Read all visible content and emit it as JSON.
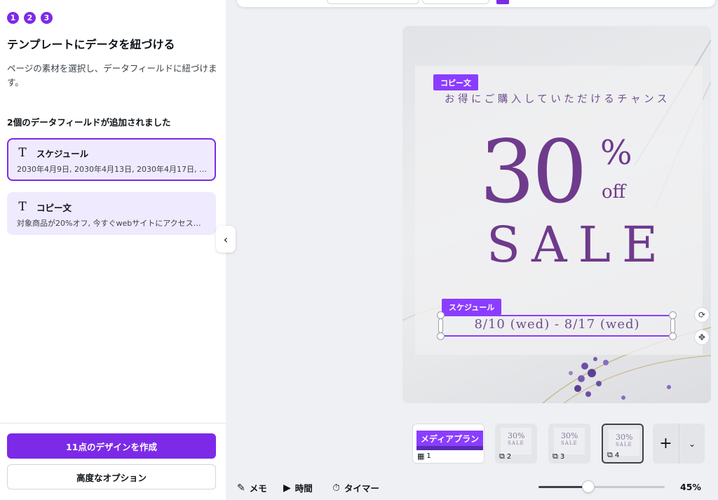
{
  "steps": [
    "1",
    "2",
    "3"
  ],
  "panel": {
    "title": "テンプレートにデータを紐づける",
    "description": "ページの素材を選択し、データフィールドに紐づけます。",
    "added_count": "2個のデータフィールドが追加されました",
    "fields": [
      {
        "icon": "text-icon",
        "name": "スケジュール",
        "value": "2030年4月9日, 2030年4月13日, 2030年4月17日, そ…"
      },
      {
        "icon": "text-icon",
        "name": "コピー文",
        "value": "対象商品が20%オフ, 今すぐwebサイトにアクセスし…"
      }
    ],
    "create_button": "11点のデザインを作成",
    "advanced_button": "高度なオプション"
  },
  "canvas": {
    "tag_copy": "コピー文",
    "headline": "お得にご購入していただけるチャンス",
    "big_number": "30",
    "percent": "%",
    "off": "off",
    "sale": "SALE",
    "tag_schedule": "スケジュール",
    "date_text": "8/10 (wed) - 8/17 (wed)"
  },
  "pages": {
    "items": [
      {
        "label": "1",
        "kind": "table",
        "banner": "メディアプラン"
      },
      {
        "label": "2",
        "kind": "design"
      },
      {
        "label": "3",
        "kind": "design"
      },
      {
        "label": "4",
        "kind": "design",
        "active": true
      }
    ],
    "thumb_30": "30%",
    "thumb_sale": "SALE"
  },
  "footer": {
    "notes": "メモ",
    "duration": "時間",
    "timer": "タイマー",
    "zoom": "45%",
    "zoom_level": 0.4
  },
  "colors": {
    "accent": "#7d2ae8",
    "tag": "#8b3dff",
    "poster_text": "#6f3a8c"
  }
}
